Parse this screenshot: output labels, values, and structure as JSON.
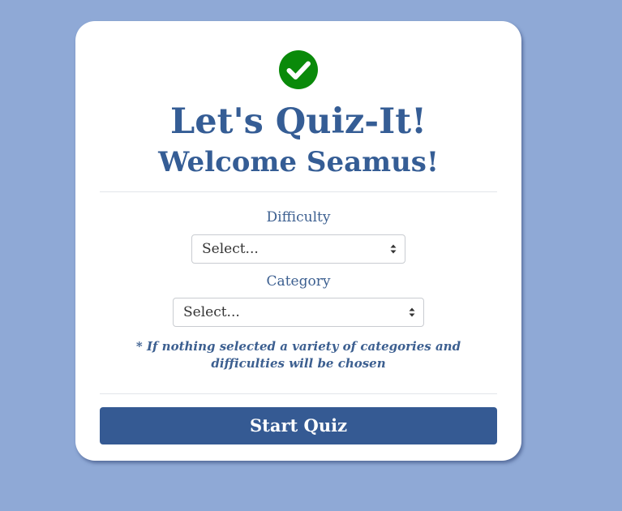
{
  "header": {
    "icon": "check-circle-icon",
    "title": "Let's Quiz-It!",
    "welcome": "Welcome Seamus!"
  },
  "form": {
    "difficulty": {
      "label": "Difficulty",
      "selected": "Select..."
    },
    "category": {
      "label": "Category",
      "selected": "Select..."
    },
    "note": "* If nothing selected a variety of categories and difficulties will be chosen"
  },
  "actions": {
    "start_label": "Start Quiz"
  },
  "colors": {
    "background": "#8fa9d6",
    "brand": "#355d95",
    "button": "#355a93",
    "check": "#0a8a0a"
  }
}
